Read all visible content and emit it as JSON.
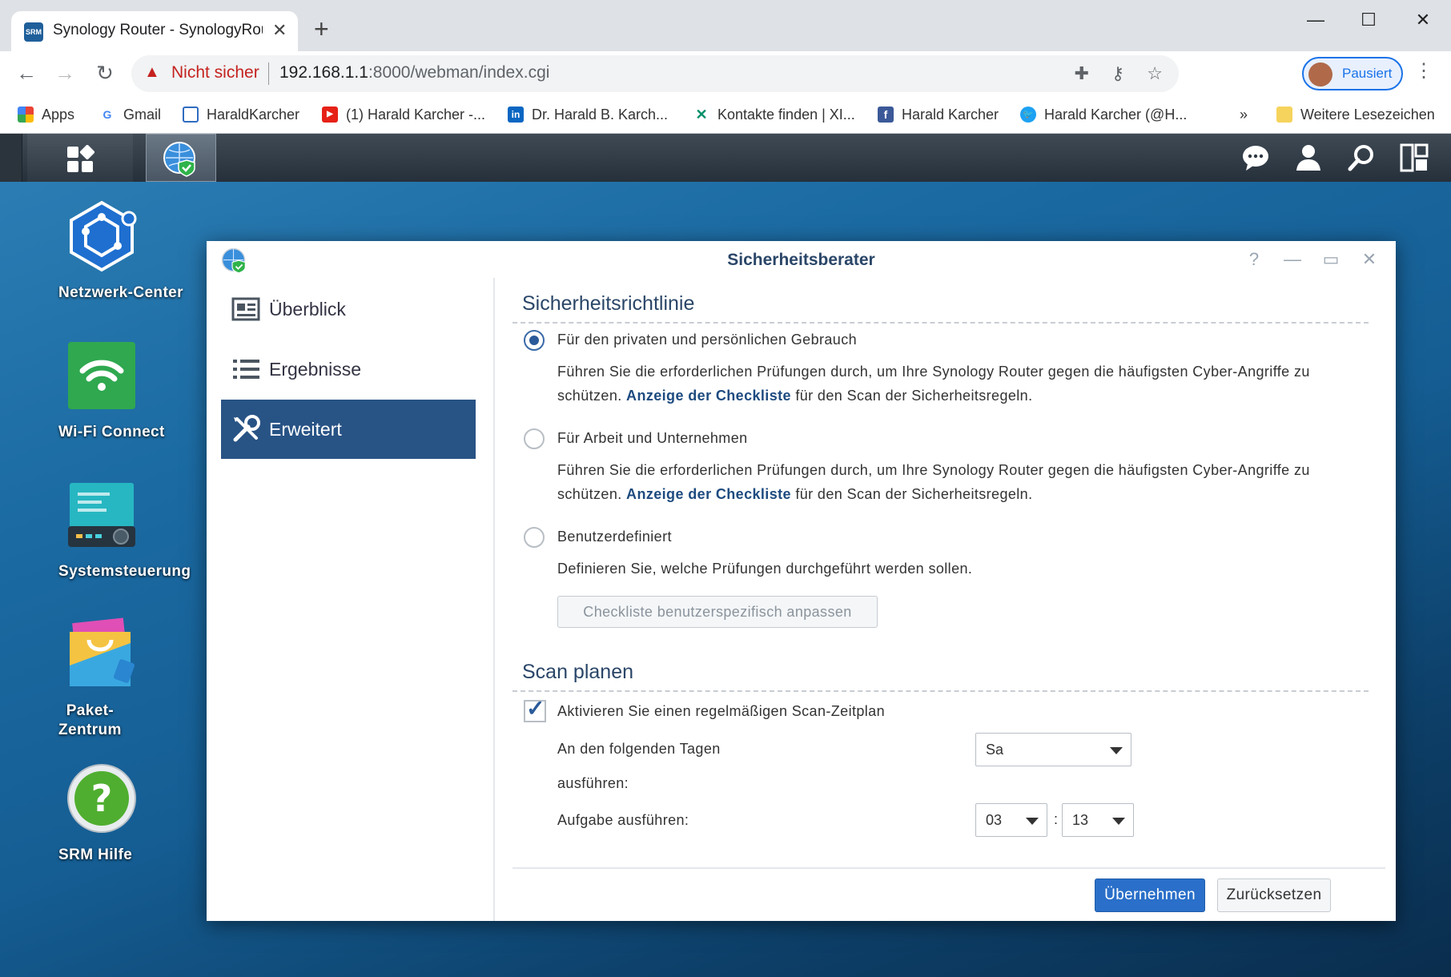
{
  "browser": {
    "tab_title": "Synology Router - SynologyRoute",
    "tab_favicon_text": "SRM",
    "security_label": "Nicht sicher",
    "url_host": "192.168.1.1",
    "url_rest": ":8000/webman/index.cgi",
    "profile_label": "Pausiert",
    "bookmarks": [
      {
        "label": "Apps",
        "icon": "apps-grid-icon"
      },
      {
        "label": "Gmail",
        "icon": "google-icon"
      },
      {
        "label": "HaraldKarcher",
        "icon": "page-icon"
      },
      {
        "label": "(1) Harald Karcher -...",
        "icon": "youtube-icon"
      },
      {
        "label": "Dr. Harald B. Karch...",
        "icon": "linkedin-icon"
      },
      {
        "label": "Kontakte finden | XI...",
        "icon": "xing-icon"
      },
      {
        "label": "Harald Karcher",
        "icon": "facebook-icon"
      },
      {
        "label": "Harald Karcher (@H...",
        "icon": "twitter-icon"
      }
    ],
    "more_bookmarks_label": "Weitere Lesezeichen",
    "overflow_label": "»"
  },
  "desktop": {
    "icons": [
      {
        "label": "Netzwerk-Center"
      },
      {
        "label": "Wi-Fi Connect"
      },
      {
        "label": "Systemsteuerung"
      },
      {
        "label": "Paket-\nZentrum"
      },
      {
        "label": "SRM Hilfe"
      }
    ]
  },
  "window": {
    "title": "Sicherheitsberater",
    "nav": [
      {
        "label": "Überblick"
      },
      {
        "label": "Ergebnisse"
      },
      {
        "label": "Erweitert"
      }
    ],
    "selected_nav": "Erweitert",
    "policy": {
      "heading": "Sicherheitsrichtlinie",
      "options": [
        {
          "label": "Für den privaten und persönlichen Gebrauch",
          "selected": true,
          "desc_pre": "Führen Sie die erforderlichen Prüfungen durch, um Ihre Synology Router gegen die häufigsten Cyber-Angriffe zu schützen. ",
          "desc_link": "Anzeige der Checkliste",
          "desc_post": " für den Scan der Sicherheitsregeln."
        },
        {
          "label": "Für Arbeit und Unternehmen",
          "selected": false,
          "desc_pre": "Führen Sie die erforderlichen Prüfungen durch, um Ihre Synology Router gegen die häufigsten Cyber-Angriffe zu schützen. ",
          "desc_link": "Anzeige der Checkliste",
          "desc_post": " für den Scan der Sicherheitsregeln."
        },
        {
          "label": "Benutzerdefiniert",
          "selected": false,
          "desc": "Definieren Sie, welche Prüfungen durchgeführt werden sollen."
        }
      ],
      "custom_button": "Checkliste benutzerspezifisch anpassen"
    },
    "schedule": {
      "heading": "Scan planen",
      "enable_label": "Aktivieren Sie einen regelmäßigen Scan-Zeitplan",
      "enabled": true,
      "days_label_1": "An den folgenden Tagen",
      "days_label_2": "ausführen:",
      "day_value": "Sa",
      "time_label": "Aufgabe ausführen:",
      "hour": "03",
      "minute": "13",
      "colon": ":"
    },
    "apply_button": "Übernehmen",
    "reset_button": "Zurücksetzen"
  }
}
